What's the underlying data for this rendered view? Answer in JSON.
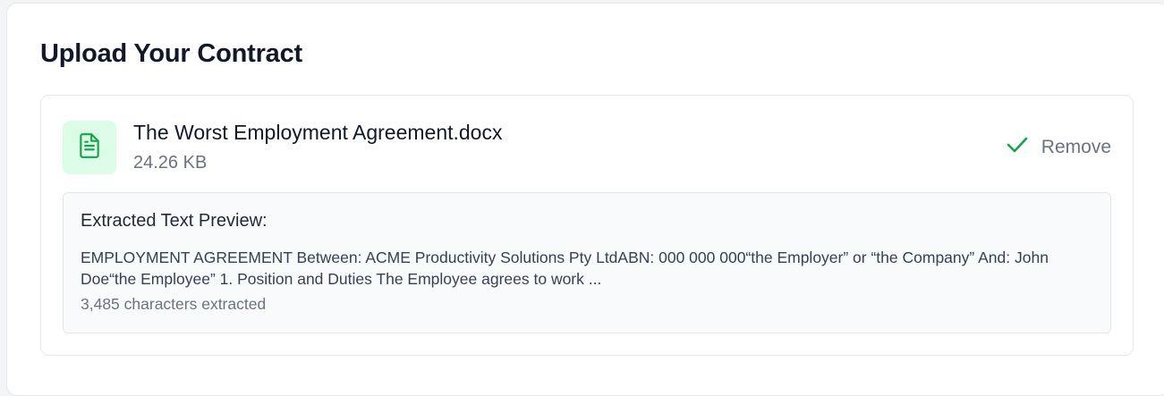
{
  "page": {
    "title": "Upload Your Contract"
  },
  "file": {
    "name": "The Worst Employment Agreement.docx",
    "size": "24.26 KB",
    "icon": "document-icon",
    "status_icon": "check-icon",
    "remove_label": "Remove"
  },
  "preview": {
    "heading": "Extracted Text Preview:",
    "text": "EMPLOYMENT AGREEMENT Between: ACME Productivity Solutions Pty LtdABN: 000 000 000“the Employer” or “the Company” And: John Doe“the Employee” 1. Position and Duties The Employee agrees to work ...",
    "char_count": "3,485 characters extracted"
  },
  "colors": {
    "accent_green": "#16a34a",
    "icon_bg": "#dcfce7"
  }
}
